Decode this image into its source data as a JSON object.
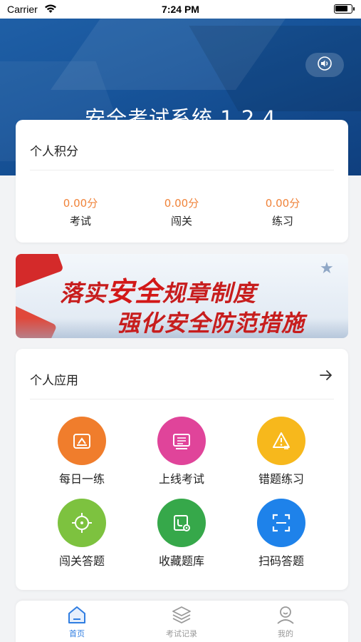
{
  "status_bar": {
    "carrier": "Carrier",
    "time": "7:24 PM"
  },
  "header": {
    "title": "安全考试系统 1.2.4",
    "sound_icon": "speaker-icon"
  },
  "score_card": {
    "title": "个人积分",
    "items": [
      {
        "value": "0.00分",
        "label": "考试"
      },
      {
        "value": "0.00分",
        "label": "闯关"
      },
      {
        "value": "0.00分",
        "label": "练习"
      }
    ],
    "value_color": "#f0833a"
  },
  "banner": {
    "line1_a": "落实",
    "line1_b": "安全",
    "line1_c": "规章制度",
    "line2": "强化安全防范措施"
  },
  "apps_card": {
    "title": "个人应用",
    "more_icon": "arrow-right-icon",
    "items": [
      {
        "label": "每日一练",
        "color": "#f07d2c",
        "icon": "daily-practice-icon"
      },
      {
        "label": "上线考试",
        "color": "#e0449a",
        "icon": "online-exam-icon"
      },
      {
        "label": "错题练习",
        "color": "#f7b81c",
        "icon": "wrong-questions-icon"
      },
      {
        "label": "闯关答题",
        "color": "#7dc23f",
        "icon": "challenge-icon"
      },
      {
        "label": "收藏题库",
        "color": "#36a84a",
        "icon": "favorites-icon"
      },
      {
        "label": "扫码答题",
        "color": "#1e82ea",
        "icon": "scan-icon"
      }
    ]
  },
  "tabbar": {
    "active_color": "#2f7de1",
    "inactive_color": "#999999",
    "tabs": [
      {
        "label": "首页",
        "icon": "home-icon",
        "active": true
      },
      {
        "label": "考试记录",
        "icon": "layers-icon",
        "active": false
      },
      {
        "label": "我的",
        "icon": "profile-icon",
        "active": false
      }
    ]
  }
}
